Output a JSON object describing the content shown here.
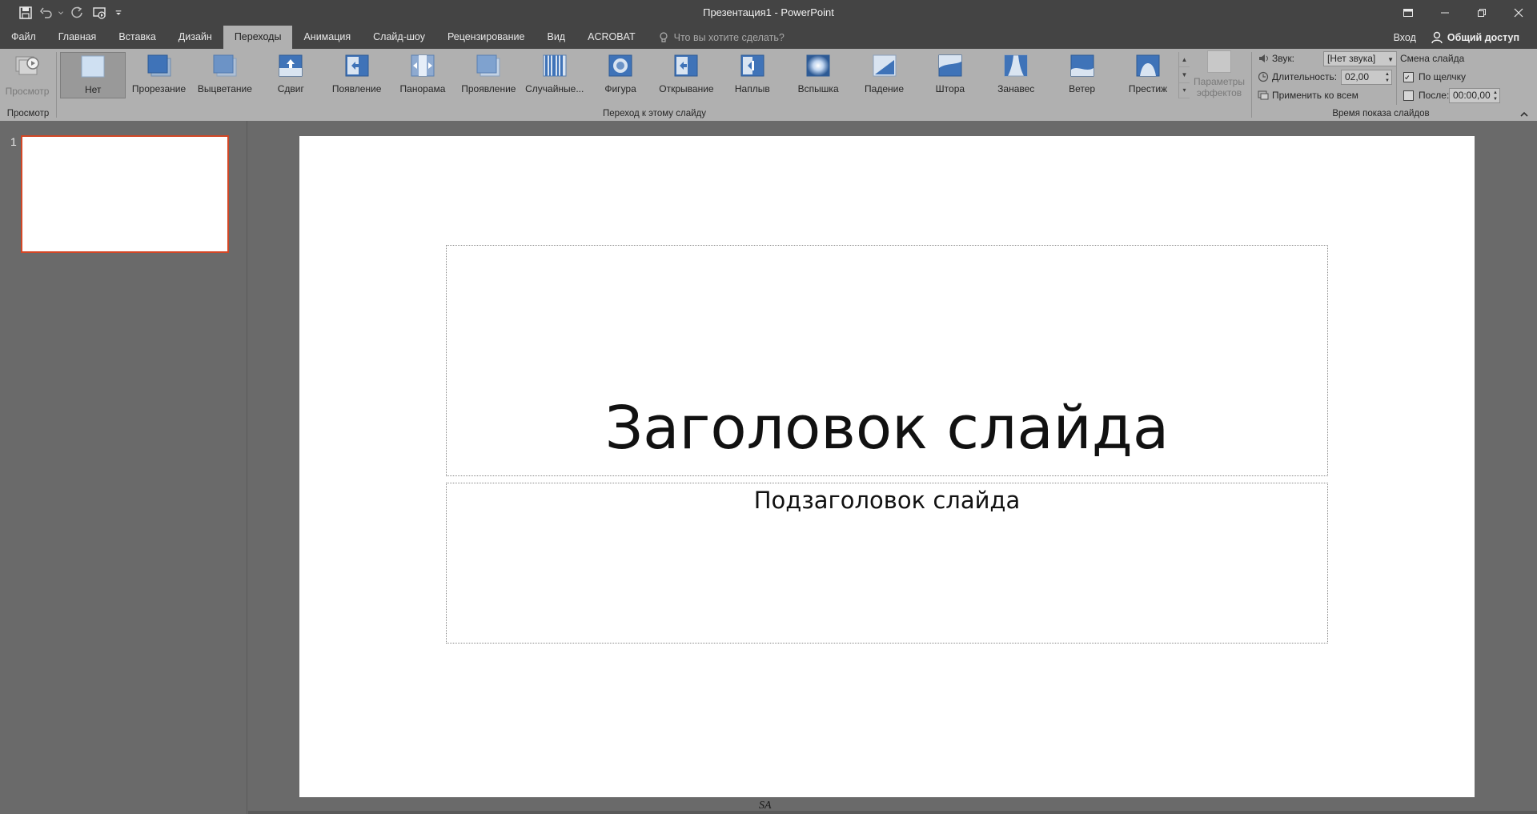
{
  "window": {
    "title": "Презентация1 - PowerPoint"
  },
  "tabs": {
    "file": "Файл",
    "items": [
      "Главная",
      "Вставка",
      "Дизайн",
      "Переходы",
      "Анимация",
      "Слайд-шоу",
      "Рецензирование",
      "Вид",
      "ACROBAT"
    ],
    "active": "Переходы",
    "tell_me_placeholder": "Что вы хотите сделать?",
    "sign_in": "Вход",
    "share": "Общий доступ"
  },
  "ribbon": {
    "preview": {
      "label": "Просмотр",
      "group_label": "Просмотр"
    },
    "transitions": {
      "group_label": "Переход к этому слайду",
      "selected": "Нет",
      "items": [
        "Нет",
        "Прорезание",
        "Выцветание",
        "Сдвиг",
        "Появление",
        "Панорама",
        "Проявление",
        "Случайные...",
        "Фигура",
        "Открывание",
        "Наплыв",
        "Вспышка",
        "Падение",
        "Штора",
        "Занавес",
        "Ветер",
        "Престиж"
      ]
    },
    "effect_options": {
      "line1": "Параметры",
      "line2": "эффектов"
    },
    "timing": {
      "group_label": "Время показа слайдов",
      "sound_label": "Звук:",
      "sound_value": "[Нет звука]",
      "duration_label": "Длительность:",
      "duration_value": "02,00",
      "apply_all": "Применить ко всем",
      "advance_title": "Смена слайда",
      "on_click_label": "По щелчку",
      "on_click_checked": true,
      "after_label": "После:",
      "after_checked": false,
      "after_value": "00:00,00"
    }
  },
  "thumbnails": {
    "items": [
      {
        "number": "1"
      }
    ]
  },
  "slide": {
    "title": "Заголовок слайда",
    "subtitle": "Подзаголовок слайда"
  },
  "watermark": "SA",
  "colors": {
    "chrome_dark": "#444444",
    "ribbon": "#b0b0b0",
    "workspace": "#6a6a6a",
    "selection_accent": "#d24726"
  }
}
